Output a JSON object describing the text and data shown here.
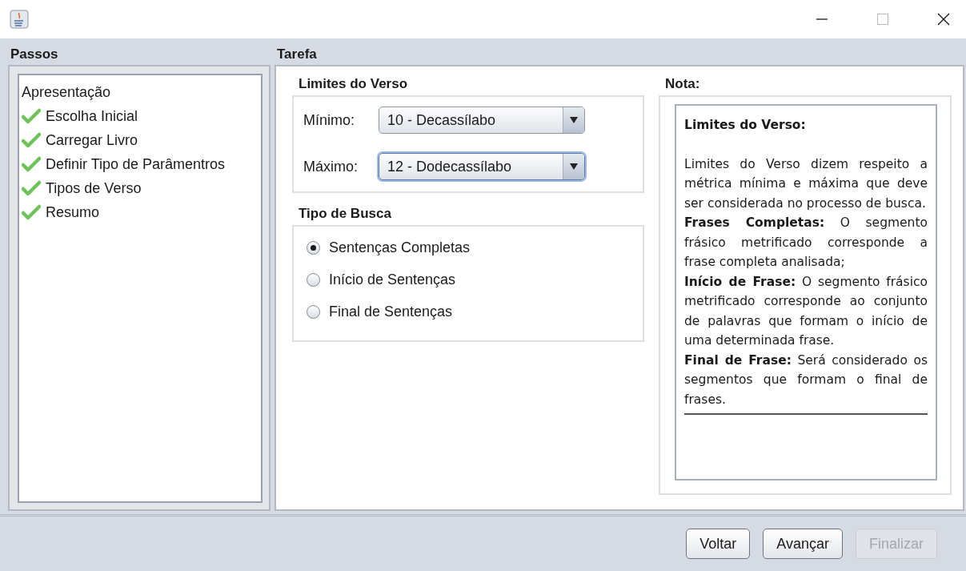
{
  "steps_panel": {
    "title": "Passos",
    "items": [
      {
        "label": "Apresentação",
        "done": false
      },
      {
        "label": "Escolha Inicial",
        "done": true
      },
      {
        "label": "Carregar Livro",
        "done": true
      },
      {
        "label": "Definir Tipo de Parâmentros",
        "done": true
      },
      {
        "label": "Tipos de Verso",
        "done": true
      },
      {
        "label": "Resumo",
        "done": true
      }
    ]
  },
  "task_panel": {
    "title": "Tarefa",
    "limits": {
      "title": "Limites do Verso",
      "fields": [
        {
          "label": "Mínimo:",
          "value": "10 - Decassílabo",
          "focused": false
        },
        {
          "label": "Máximo:",
          "value": "12 - Dodecassílabo",
          "focused": true
        }
      ]
    },
    "search_type": {
      "title": "Tipo de Busca",
      "options": [
        {
          "label": "Sentenças Completas",
          "selected": true
        },
        {
          "label": "Início de Sentenças",
          "selected": false
        },
        {
          "label": "Final de Sentenças",
          "selected": false
        }
      ]
    },
    "note": {
      "title": "Nota:",
      "heading": "Limites do Verso:",
      "paragraphs": [
        "Limites do Verso dizem respeito a métrica mínima e máxima que deve ser considerada no processo de busca.",
        "**Frases Completas:** O segmento frásico metrificado corresponde a frase completa analisada;",
        "**Início de Frase:** O segmento frásico metrificado corresponde ao conjunto de palavras que formam o início de uma determinada frase.",
        "**Final de Frase:** Será considerado os segmentos que formam o final de frases."
      ]
    }
  },
  "buttons": [
    {
      "label": "Voltar",
      "disabled": false
    },
    {
      "label": "Avançar",
      "disabled": false
    },
    {
      "label": "Finalizar",
      "disabled": true
    }
  ]
}
